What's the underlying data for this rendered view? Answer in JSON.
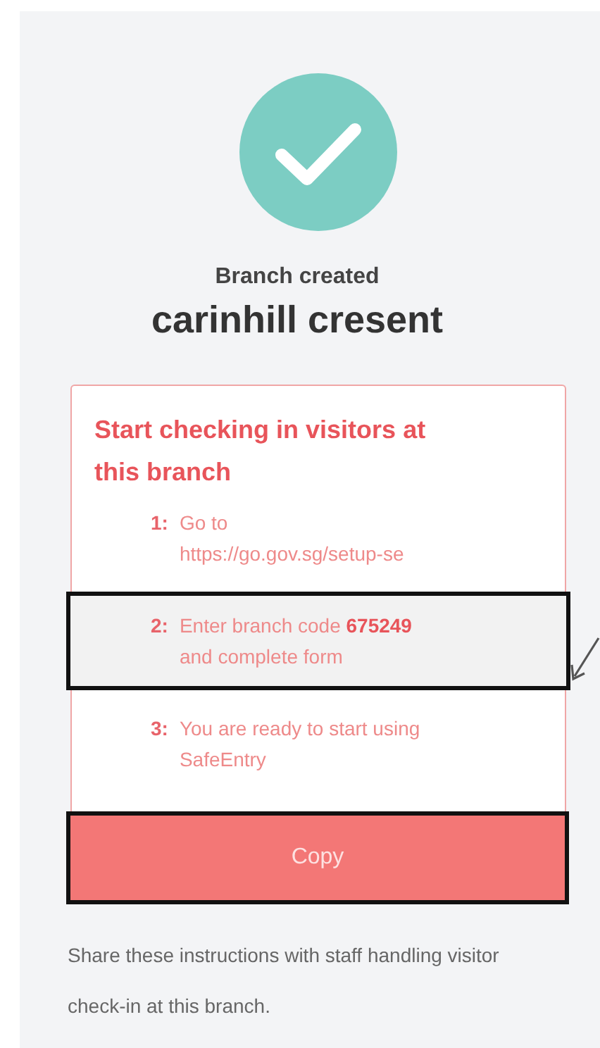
{
  "status": {
    "label": "Branch created"
  },
  "branch_name": "carinhill cresent",
  "instructions": {
    "title": "Start checking in visitors at this branch",
    "steps": [
      {
        "number": "1:",
        "text": "Go to https://go.gov.sg/setup-se",
        "highlighted": false
      },
      {
        "number": "2:",
        "text": "Enter branch code **675249** and complete form",
        "highlighted": true
      },
      {
        "number": "3:",
        "text": "You are ready to start using SafeEntry",
        "highlighted": false
      }
    ]
  },
  "copy_button": {
    "label": "Copy",
    "highlighted": true
  },
  "footer": "Share these instructions with staff handling visitor check-in at this branch."
}
